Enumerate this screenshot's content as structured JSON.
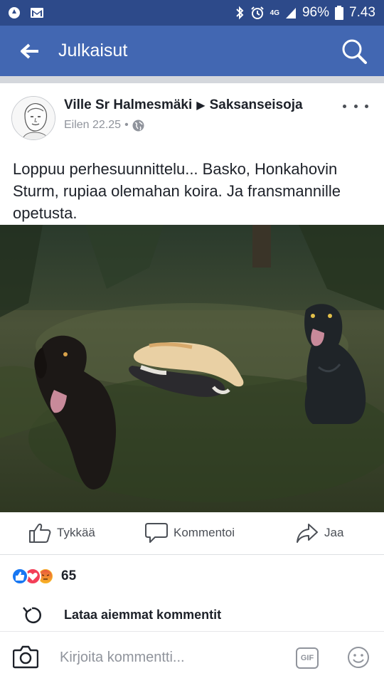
{
  "status_bar": {
    "network": "4G",
    "battery": "96%",
    "time": "7.43",
    "icons": [
      "notification-circle-icon",
      "gmail-icon",
      "bluetooth-icon",
      "alarm-icon",
      "signal-icon",
      "battery-icon"
    ]
  },
  "app_bar": {
    "title": "Julkaisut",
    "back_icon": "arrow-left-icon",
    "search_icon": "search-icon"
  },
  "post": {
    "author": "Ville Sr Halmesmäki",
    "target": "Saksanseisoja",
    "timestamp": "Eilen 22.25",
    "separator": "•",
    "privacy_icon": "globe-icon",
    "text": "Loppuu perhesuunnittelu... Basko, Honkahovin Sturm, rupiaa olemahan koira. Ja fransmannille opetusta."
  },
  "actions": {
    "like": "Tykkää",
    "comment": "Kommentoi",
    "share": "Jaa"
  },
  "reactions": {
    "types": [
      "like",
      "love",
      "angry"
    ],
    "count": "65"
  },
  "load_comments": "Lataa aiemmat kommentit",
  "composer": {
    "placeholder": "Kirjoita kommentti...",
    "gif_label": "GIF"
  },
  "colors": {
    "status_bar": "#2d4a8a",
    "app_bar": "#4267b2",
    "like_blue": "#1877f2",
    "love_red": "#f33e58",
    "angry_yellow": "#f7b125"
  }
}
